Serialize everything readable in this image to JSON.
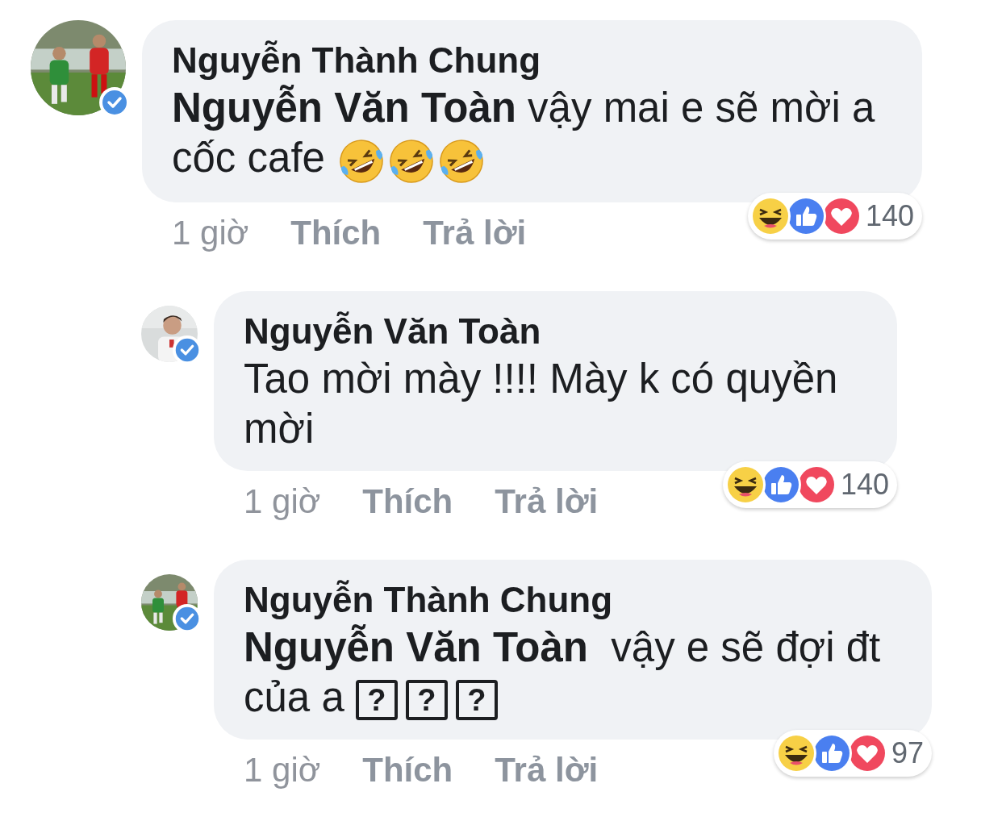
{
  "comments": [
    {
      "author": "Nguyễn Thành Chung",
      "verified": true,
      "body": [
        {
          "kind": "mention",
          "text": "Nguyễn Văn Toàn"
        },
        {
          "kind": "text",
          "text": " vậy mai e sẽ mời a cốc cafe "
        },
        {
          "kind": "emoji"
        },
        {
          "kind": "emoji"
        },
        {
          "kind": "emoji"
        }
      ],
      "time": "1 giờ",
      "actions": [
        "Thích",
        "Trả lời"
      ],
      "reactions": [
        {
          "kind": "haha"
        },
        {
          "kind": "like"
        },
        {
          "kind": "love"
        }
      ],
      "reaction_count": "140",
      "replies": [
        {
          "author": "Nguyễn Văn Toàn",
          "verified": true,
          "body": [
            {
              "kind": "text",
              "text": "Tao mời mày !!!! Mày k có quyền mời"
            }
          ],
          "time": "1 giờ",
          "actions": [
            "Thích",
            "Trả lời"
          ],
          "reactions": [
            {
              "kind": "haha"
            },
            {
              "kind": "like"
            },
            {
              "kind": "love"
            }
          ],
          "reaction_count": "140"
        },
        {
          "author": "Nguyễn Thành Chung",
          "verified": true,
          "body": [
            {
              "kind": "mention",
              "text": "Nguyễn Văn Toàn"
            },
            {
              "kind": "text",
              "text": "  vậy e sẽ đợi đt của a "
            },
            {
              "kind": "missing",
              "text": "?"
            },
            {
              "kind": "missing",
              "text": "?"
            },
            {
              "kind": "missing",
              "text": "?"
            }
          ],
          "time": "1 giờ",
          "actions": [
            "Thích",
            "Trả lời"
          ],
          "reactions": [
            {
              "kind": "haha"
            },
            {
              "kind": "like"
            },
            {
              "kind": "love"
            }
          ],
          "reaction_count": "97"
        }
      ]
    }
  ]
}
